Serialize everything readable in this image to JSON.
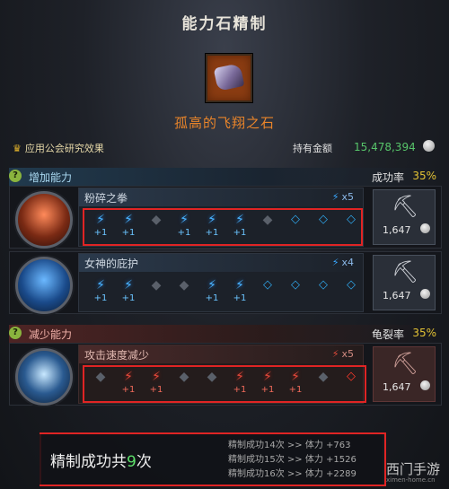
{
  "title": "能力石精制",
  "stone": {
    "name": "孤高的飞翔之石",
    "icon": "stone-icon"
  },
  "guild_research": "应用公会研究效果",
  "gold": {
    "label": "持有金额",
    "value": "15,478,394"
  },
  "increase": {
    "label": "增加能力",
    "rate_label": "成功率",
    "rate_value": "35%",
    "skills": [
      {
        "name": "粉碎之拳",
        "multiplier": "x5",
        "slots": [
          {
            "state": "on",
            "bonus": "+1"
          },
          {
            "state": "on",
            "bonus": "+1"
          },
          {
            "state": "off",
            "bonus": ""
          },
          {
            "state": "on",
            "bonus": "+1"
          },
          {
            "state": "on",
            "bonus": "+1"
          },
          {
            "state": "on",
            "bonus": "+1"
          },
          {
            "state": "off",
            "bonus": ""
          },
          {
            "state": "empty",
            "bonus": ""
          },
          {
            "state": "empty",
            "bonus": ""
          },
          {
            "state": "empty",
            "bonus": ""
          }
        ],
        "cost": "1,647"
      },
      {
        "name": "女神的庇护",
        "multiplier": "x4",
        "slots": [
          {
            "state": "on",
            "bonus": "+1"
          },
          {
            "state": "on",
            "bonus": "+1"
          },
          {
            "state": "off",
            "bonus": ""
          },
          {
            "state": "off",
            "bonus": ""
          },
          {
            "state": "on",
            "bonus": "+1"
          },
          {
            "state": "on",
            "bonus": "+1"
          },
          {
            "state": "empty",
            "bonus": ""
          },
          {
            "state": "empty",
            "bonus": ""
          },
          {
            "state": "empty",
            "bonus": ""
          },
          {
            "state": "empty",
            "bonus": ""
          }
        ],
        "cost": "1,647"
      }
    ]
  },
  "decrease": {
    "label": "减少能力",
    "rate_label": "龟裂率",
    "rate_value": "35%",
    "skill": {
      "name": "攻击速度减少",
      "multiplier": "x5",
      "slots": [
        {
          "state": "off",
          "bonus": ""
        },
        {
          "state": "on",
          "bonus": "+1"
        },
        {
          "state": "on",
          "bonus": "+1"
        },
        {
          "state": "off",
          "bonus": ""
        },
        {
          "state": "off",
          "bonus": ""
        },
        {
          "state": "on",
          "bonus": "+1"
        },
        {
          "state": "on",
          "bonus": "+1"
        },
        {
          "state": "on",
          "bonus": "+1"
        },
        {
          "state": "off",
          "bonus": ""
        },
        {
          "state": "empty",
          "bonus": ""
        }
      ],
      "cost": "1,647"
    }
  },
  "summary": {
    "prefix": "精制成功共",
    "count": "9",
    "suffix": "次",
    "stages": [
      "精制成功14次 >> 体力 +763",
      "精制成功15次 >> 体力 +1526",
      "精制成功16次 >> 体力 +2289"
    ]
  },
  "watermark": {
    "text": "西门手游",
    "sub": "ximen-home.cn"
  }
}
